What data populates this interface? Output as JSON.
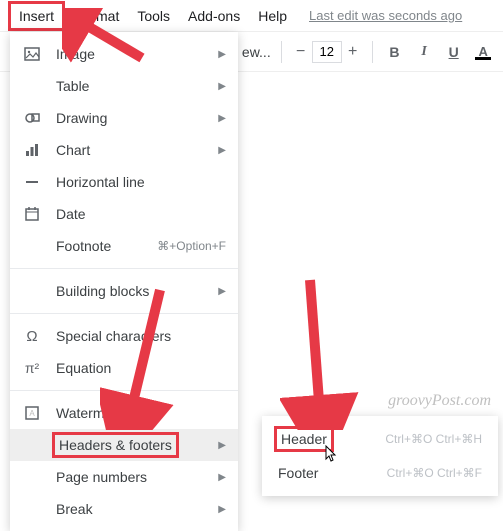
{
  "menubar": {
    "insert": "Insert",
    "format": "Format",
    "tools": "Tools",
    "addons": "Add-ons",
    "help": "Help",
    "last_edit": "Last edit was seconds ago"
  },
  "toolbar": {
    "font_partial": "ew...",
    "minus": "−",
    "font_size": "12",
    "plus": "+",
    "bold": "B",
    "italic": "I",
    "underline": "U",
    "color": "A"
  },
  "menu": {
    "image": "Image",
    "table": "Table",
    "drawing": "Drawing",
    "chart": "Chart",
    "horizontal_line": "Horizontal line",
    "date": "Date",
    "footnote": "Footnote",
    "footnote_shortcut": "⌘+Option+F",
    "building_blocks": "Building blocks",
    "special_chars": "Special characters",
    "equation": "Equation",
    "watermark": "Watermark",
    "headers_footers": "Headers & footers",
    "page_numbers": "Page numbers",
    "break": "Break"
  },
  "submenu": {
    "header": "Header",
    "header_shortcut": "Ctrl+⌘O Ctrl+⌘H",
    "footer": "Footer",
    "footer_shortcut": "Ctrl+⌘O Ctrl+⌘F"
  },
  "watermark_text": "groovyPost.com"
}
